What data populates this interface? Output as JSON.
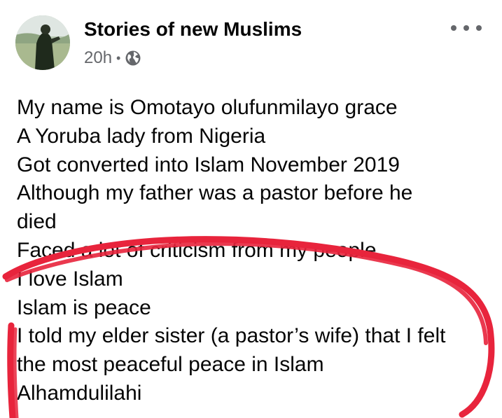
{
  "post": {
    "page_name": "Stories of new Muslims",
    "time_ago": "20h",
    "separator": "•",
    "privacy_icon": "globe-icon",
    "more_icon": "more-options-icon",
    "lines": [
      "My name is Omotayo olufunmilayo grace",
      "A Yoruba lady from Nigeria",
      "Got converted into Islam November 2019",
      "Although my father was a pastor before he",
      "died",
      "Faced a lot of criticism from my people",
      "I love Islam",
      "Islam is peace",
      "I told my elder sister (a pastor’s wife) that I felt",
      "the most peaceful peace in Islam",
      "Alhamdulilahi"
    ]
  },
  "colors": {
    "text_primary": "#050505",
    "text_secondary": "#65676b",
    "annotation_red": "#e8243c"
  }
}
